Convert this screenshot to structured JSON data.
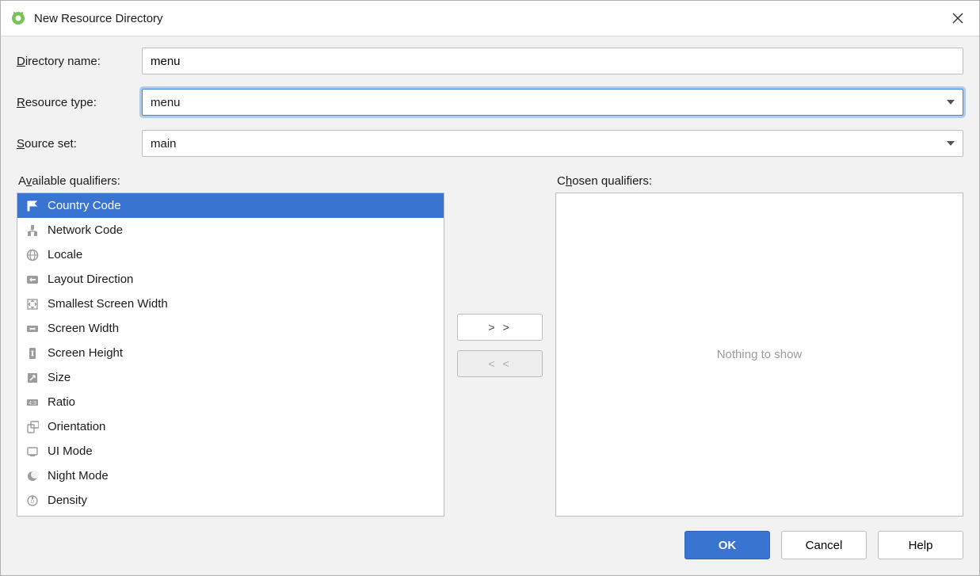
{
  "title": "New Resource Directory",
  "labels": {
    "directory_name": "Directory name:",
    "resource_type": "Resource type:",
    "source_set": "Source set:",
    "available": "Available qualifiers:",
    "chosen": "Chosen qualifiers:"
  },
  "fields": {
    "directory_name": "menu",
    "resource_type": "menu",
    "source_set": "main"
  },
  "move": {
    "add": "> >",
    "remove": "< <"
  },
  "available_qualifiers": [
    {
      "label": "Country Code",
      "icon": "flag-icon",
      "selected": true
    },
    {
      "label": "Network Code",
      "icon": "network-icon",
      "selected": false
    },
    {
      "label": "Locale",
      "icon": "globe-icon",
      "selected": false
    },
    {
      "label": "Layout Direction",
      "icon": "direction-icon",
      "selected": false
    },
    {
      "label": "Smallest Screen Width",
      "icon": "expand-icon",
      "selected": false
    },
    {
      "label": "Screen Width",
      "icon": "width-icon",
      "selected": false
    },
    {
      "label": "Screen Height",
      "icon": "height-icon",
      "selected": false
    },
    {
      "label": "Size",
      "icon": "size-icon",
      "selected": false
    },
    {
      "label": "Ratio",
      "icon": "ratio-icon",
      "selected": false
    },
    {
      "label": "Orientation",
      "icon": "orientation-icon",
      "selected": false
    },
    {
      "label": "UI Mode",
      "icon": "uimode-icon",
      "selected": false
    },
    {
      "label": "Night Mode",
      "icon": "night-icon",
      "selected": false
    },
    {
      "label": "Density",
      "icon": "density-icon",
      "selected": false
    }
  ],
  "chosen_qualifiers_empty": "Nothing to show",
  "buttons": {
    "ok": "OK",
    "cancel": "Cancel",
    "help": "Help"
  },
  "mnemonics": {
    "directory_name": "D",
    "resource_type": "R",
    "source_set": "S",
    "available": "v",
    "chosen": "h"
  }
}
